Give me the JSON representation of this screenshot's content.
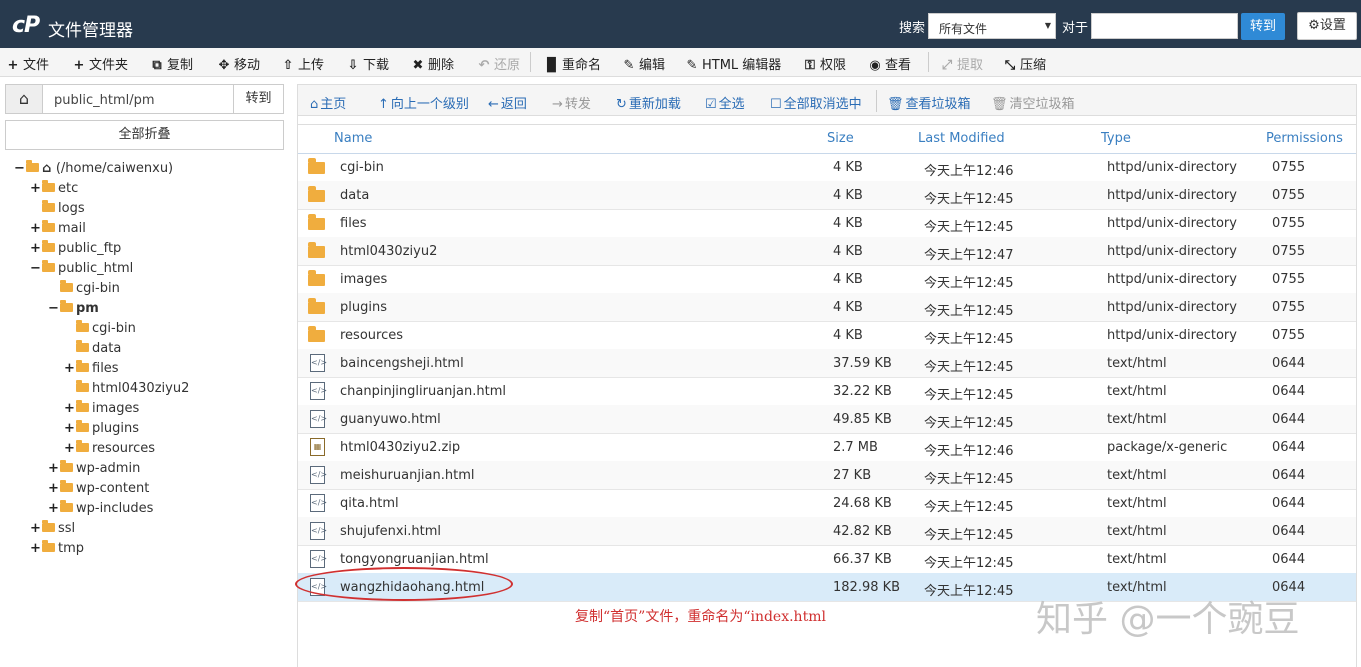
{
  "topbar": {
    "logo": "cP",
    "title": "文件管理器",
    "search_label": "搜索",
    "search_scope": "所有文件",
    "for_label": "对于",
    "search_value": "",
    "go_label": "转到",
    "settings_label": "设置"
  },
  "toolbar": {
    "items": [
      {
        "label": "文件",
        "icon": "plus-icon",
        "glyph": "+"
      },
      {
        "label": "文件夹",
        "icon": "plus-icon",
        "glyph": "+"
      },
      {
        "label": "复制",
        "icon": "copy-icon",
        "glyph": "⧉"
      },
      {
        "label": "移动",
        "icon": "move-icon",
        "glyph": "✥"
      },
      {
        "label": "上传",
        "icon": "upload-icon",
        "glyph": "⇧"
      },
      {
        "label": "下载",
        "icon": "download-icon",
        "glyph": "⇩"
      },
      {
        "label": "删除",
        "icon": "delete-icon",
        "glyph": "✖"
      },
      {
        "label": "还原",
        "icon": "undo-icon",
        "glyph": "↶"
      },
      {
        "label": "重命名",
        "icon": "rename-icon",
        "glyph": "▉"
      },
      {
        "label": "编辑",
        "icon": "pencil-icon",
        "glyph": "✎"
      },
      {
        "label": "HTML 编辑器",
        "icon": "html-edit-icon",
        "glyph": "✎"
      },
      {
        "label": "权限",
        "icon": "key-icon",
        "glyph": "⚿"
      },
      {
        "label": "查看",
        "icon": "eye-icon",
        "glyph": "◉"
      },
      {
        "label": "提取",
        "icon": "extract-icon",
        "glyph": "⤢"
      },
      {
        "label": "压缩",
        "icon": "compress-icon",
        "glyph": "⤡"
      }
    ]
  },
  "left": {
    "path_value": "public_html/pm",
    "go_label": "转到",
    "collapse_label": "全部折叠",
    "tree": [
      {
        "label": "(/home/caiwenxu)",
        "toggle": "−",
        "kind": "home"
      },
      {
        "label": "etc",
        "toggle": "+"
      },
      {
        "label": "logs",
        "toggle": ""
      },
      {
        "label": "mail",
        "toggle": "+"
      },
      {
        "label": "public_ftp",
        "toggle": "+"
      },
      {
        "label": "public_html",
        "toggle": "−"
      },
      {
        "label": "cgi-bin",
        "toggle": ""
      },
      {
        "label": "pm",
        "toggle": "−"
      },
      {
        "label": "cgi-bin",
        "toggle": ""
      },
      {
        "label": "data",
        "toggle": ""
      },
      {
        "label": "files",
        "toggle": "+"
      },
      {
        "label": "html0430ziyu2",
        "toggle": ""
      },
      {
        "label": "images",
        "toggle": "+"
      },
      {
        "label": "plugins",
        "toggle": "+"
      },
      {
        "label": "resources",
        "toggle": "+"
      },
      {
        "label": "wp-admin",
        "toggle": "+"
      },
      {
        "label": "wp-content",
        "toggle": "+"
      },
      {
        "label": "wp-includes",
        "toggle": "+"
      },
      {
        "label": "ssl",
        "toggle": "+"
      },
      {
        "label": "tmp",
        "toggle": "+"
      }
    ]
  },
  "actions": {
    "items": [
      {
        "label": "主页",
        "icon": "home-icon",
        "glyph": "⌂"
      },
      {
        "label": "向上一个级别",
        "icon": "level-up-icon",
        "glyph": "↑"
      },
      {
        "label": "返回",
        "icon": "back-icon",
        "glyph": "←"
      },
      {
        "label": "转发",
        "icon": "forward-icon",
        "glyph": "→"
      },
      {
        "label": "重新加载",
        "icon": "reload-icon",
        "glyph": "↻"
      },
      {
        "label": "全选",
        "icon": "check-icon",
        "glyph": "☑"
      },
      {
        "label": "全部取消选中",
        "icon": "square-icon",
        "glyph": "☐"
      },
      {
        "label": "查看垃圾箱",
        "icon": "trash-icon",
        "glyph": "🗑"
      },
      {
        "label": "清空垃圾箱",
        "icon": "trash-empty-icon",
        "glyph": "🗑"
      }
    ]
  },
  "table": {
    "headers": {
      "name": "Name",
      "size": "Size",
      "modified": "Last Modified",
      "type": "Type",
      "perms": "Permissions"
    },
    "rows": [
      {
        "name": "cgi-bin",
        "size": "4 KB",
        "modified": "今天上午12:46",
        "type": "httpd/unix-directory",
        "perms": "0755",
        "kind": "folder"
      },
      {
        "name": "data",
        "size": "4 KB",
        "modified": "今天上午12:45",
        "type": "httpd/unix-directory",
        "perms": "0755",
        "kind": "folder"
      },
      {
        "name": "files",
        "size": "4 KB",
        "modified": "今天上午12:45",
        "type": "httpd/unix-directory",
        "perms": "0755",
        "kind": "folder"
      },
      {
        "name": "html0430ziyu2",
        "size": "4 KB",
        "modified": "今天上午12:47",
        "type": "httpd/unix-directory",
        "perms": "0755",
        "kind": "folder"
      },
      {
        "name": "images",
        "size": "4 KB",
        "modified": "今天上午12:45",
        "type": "httpd/unix-directory",
        "perms": "0755",
        "kind": "folder"
      },
      {
        "name": "plugins",
        "size": "4 KB",
        "modified": "今天上午12:45",
        "type": "httpd/unix-directory",
        "perms": "0755",
        "kind": "folder"
      },
      {
        "name": "resources",
        "size": "4 KB",
        "modified": "今天上午12:45",
        "type": "httpd/unix-directory",
        "perms": "0755",
        "kind": "folder"
      },
      {
        "name": "baincengsheji.html",
        "size": "37.59 KB",
        "modified": "今天上午12:45",
        "type": "text/html",
        "perms": "0644",
        "kind": "html"
      },
      {
        "name": "chanpinjingliruanjan.html",
        "size": "32.22 KB",
        "modified": "今天上午12:45",
        "type": "text/html",
        "perms": "0644",
        "kind": "html"
      },
      {
        "name": "guanyuwo.html",
        "size": "49.85 KB",
        "modified": "今天上午12:45",
        "type": "text/html",
        "perms": "0644",
        "kind": "html"
      },
      {
        "name": "html0430ziyu2.zip",
        "size": "2.7 MB",
        "modified": "今天上午12:46",
        "type": "package/x-generic",
        "perms": "0644",
        "kind": "zip"
      },
      {
        "name": "meishuruanjian.html",
        "size": "27 KB",
        "modified": "今天上午12:45",
        "type": "text/html",
        "perms": "0644",
        "kind": "html"
      },
      {
        "name": "qita.html",
        "size": "24.68 KB",
        "modified": "今天上午12:45",
        "type": "text/html",
        "perms": "0644",
        "kind": "html"
      },
      {
        "name": "shujufenxi.html",
        "size": "42.82 KB",
        "modified": "今天上午12:45",
        "type": "text/html",
        "perms": "0644",
        "kind": "html"
      },
      {
        "name": "tongyongruanjian.html",
        "size": "66.37 KB",
        "modified": "今天上午12:45",
        "type": "text/html",
        "perms": "0644",
        "kind": "html"
      },
      {
        "name": "wangzhidaohang.html",
        "size": "182.98 KB",
        "modified": "今天上午12:45",
        "type": "text/html",
        "perms": "0644",
        "kind": "html",
        "selected": true
      }
    ]
  },
  "annotation": "复制“首页”文件，重命名为“index.html",
  "watermark": "知乎 @一个豌豆",
  "colors": {
    "topbar": "#283a4e",
    "accent": "#2f8ad6",
    "folder": "#f0ad3e",
    "annotation": "#d03030",
    "selected_row": "#d9ebf9"
  }
}
